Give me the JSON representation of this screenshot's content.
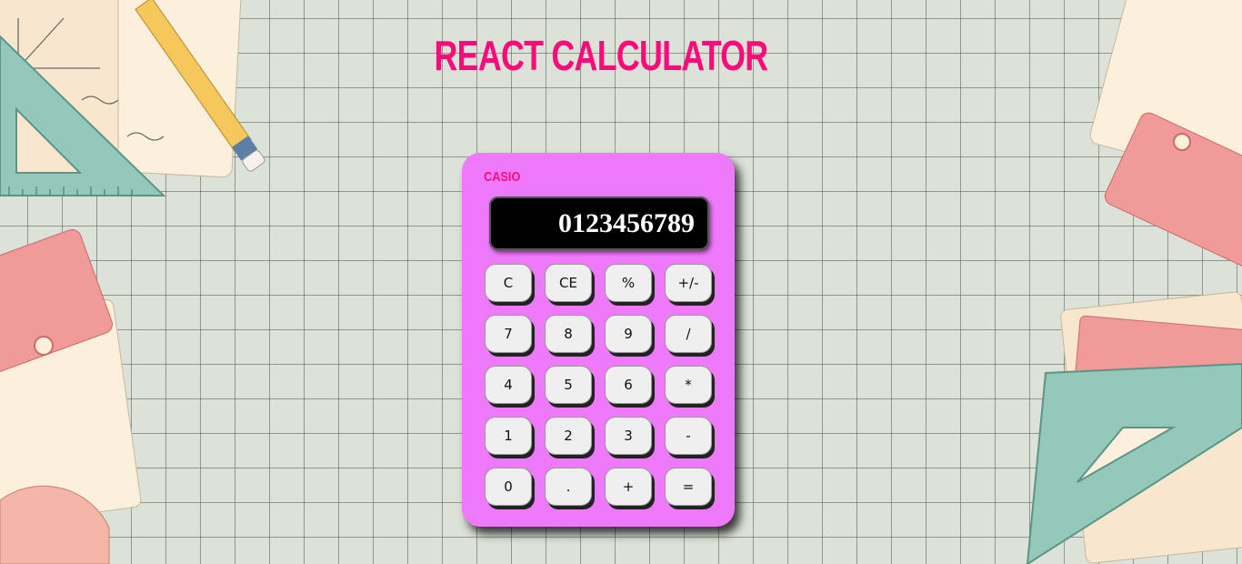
{
  "header": {
    "title": "REACT CALCULATOR"
  },
  "calculator": {
    "brand": "CASIO",
    "display": "0123456789",
    "keys": [
      {
        "label": "C",
        "name": "key-clear"
      },
      {
        "label": "CE",
        "name": "key-clear-entry"
      },
      {
        "label": "%",
        "name": "key-percent"
      },
      {
        "label": "+/-",
        "name": "key-toggle-sign"
      },
      {
        "label": "7",
        "name": "key-7"
      },
      {
        "label": "8",
        "name": "key-8"
      },
      {
        "label": "9",
        "name": "key-9"
      },
      {
        "label": "/",
        "name": "key-divide"
      },
      {
        "label": "4",
        "name": "key-4"
      },
      {
        "label": "5",
        "name": "key-5"
      },
      {
        "label": "6",
        "name": "key-6"
      },
      {
        "label": "*",
        "name": "key-multiply"
      },
      {
        "label": "1",
        "name": "key-1"
      },
      {
        "label": "2",
        "name": "key-2"
      },
      {
        "label": "3",
        "name": "key-3"
      },
      {
        "label": "-",
        "name": "key-subtract"
      },
      {
        "label": "0",
        "name": "key-0"
      },
      {
        "label": ".",
        "name": "key-decimal"
      },
      {
        "label": "+",
        "name": "key-add"
      },
      {
        "label": "=",
        "name": "key-equals"
      }
    ]
  },
  "theme": {
    "background": "#dde2d8",
    "accent": "#ff0a7a",
    "calculator_body": "#ee79fb",
    "display_bg": "#000000",
    "key_bg": "#efefef"
  }
}
